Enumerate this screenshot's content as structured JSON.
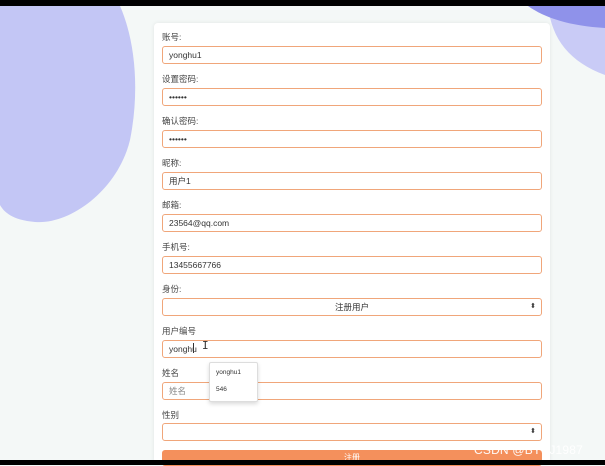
{
  "form": {
    "account": {
      "label": "账号:",
      "value": "yonghu1"
    },
    "password": {
      "label": "设置密码:",
      "value": "••••••"
    },
    "confirm_password": {
      "label": "确认密码:",
      "value": "••••••"
    },
    "nickname": {
      "label": "昵称:",
      "value": "用户1"
    },
    "email": {
      "label": "邮箱:",
      "value": "23564@qq.com"
    },
    "phone": {
      "label": "手机号:",
      "value": "13455667766"
    },
    "identity": {
      "label": "身份:",
      "selected": "注册用户"
    },
    "user_number": {
      "label": "用户编号",
      "value": "yonghu"
    },
    "name": {
      "label": "姓名",
      "placeholder": "姓名"
    },
    "gender": {
      "label": "性别",
      "selected": ""
    },
    "submit_label": "注册"
  },
  "autocomplete": {
    "items": [
      "yonghu1",
      "546"
    ]
  },
  "watermark": "CSDN @BYSJ1987",
  "colors": {
    "input_border": "#f0a67a",
    "button": "#f4905c",
    "blob": "#c3c6f5",
    "blob_dark": "#8f92ea"
  }
}
